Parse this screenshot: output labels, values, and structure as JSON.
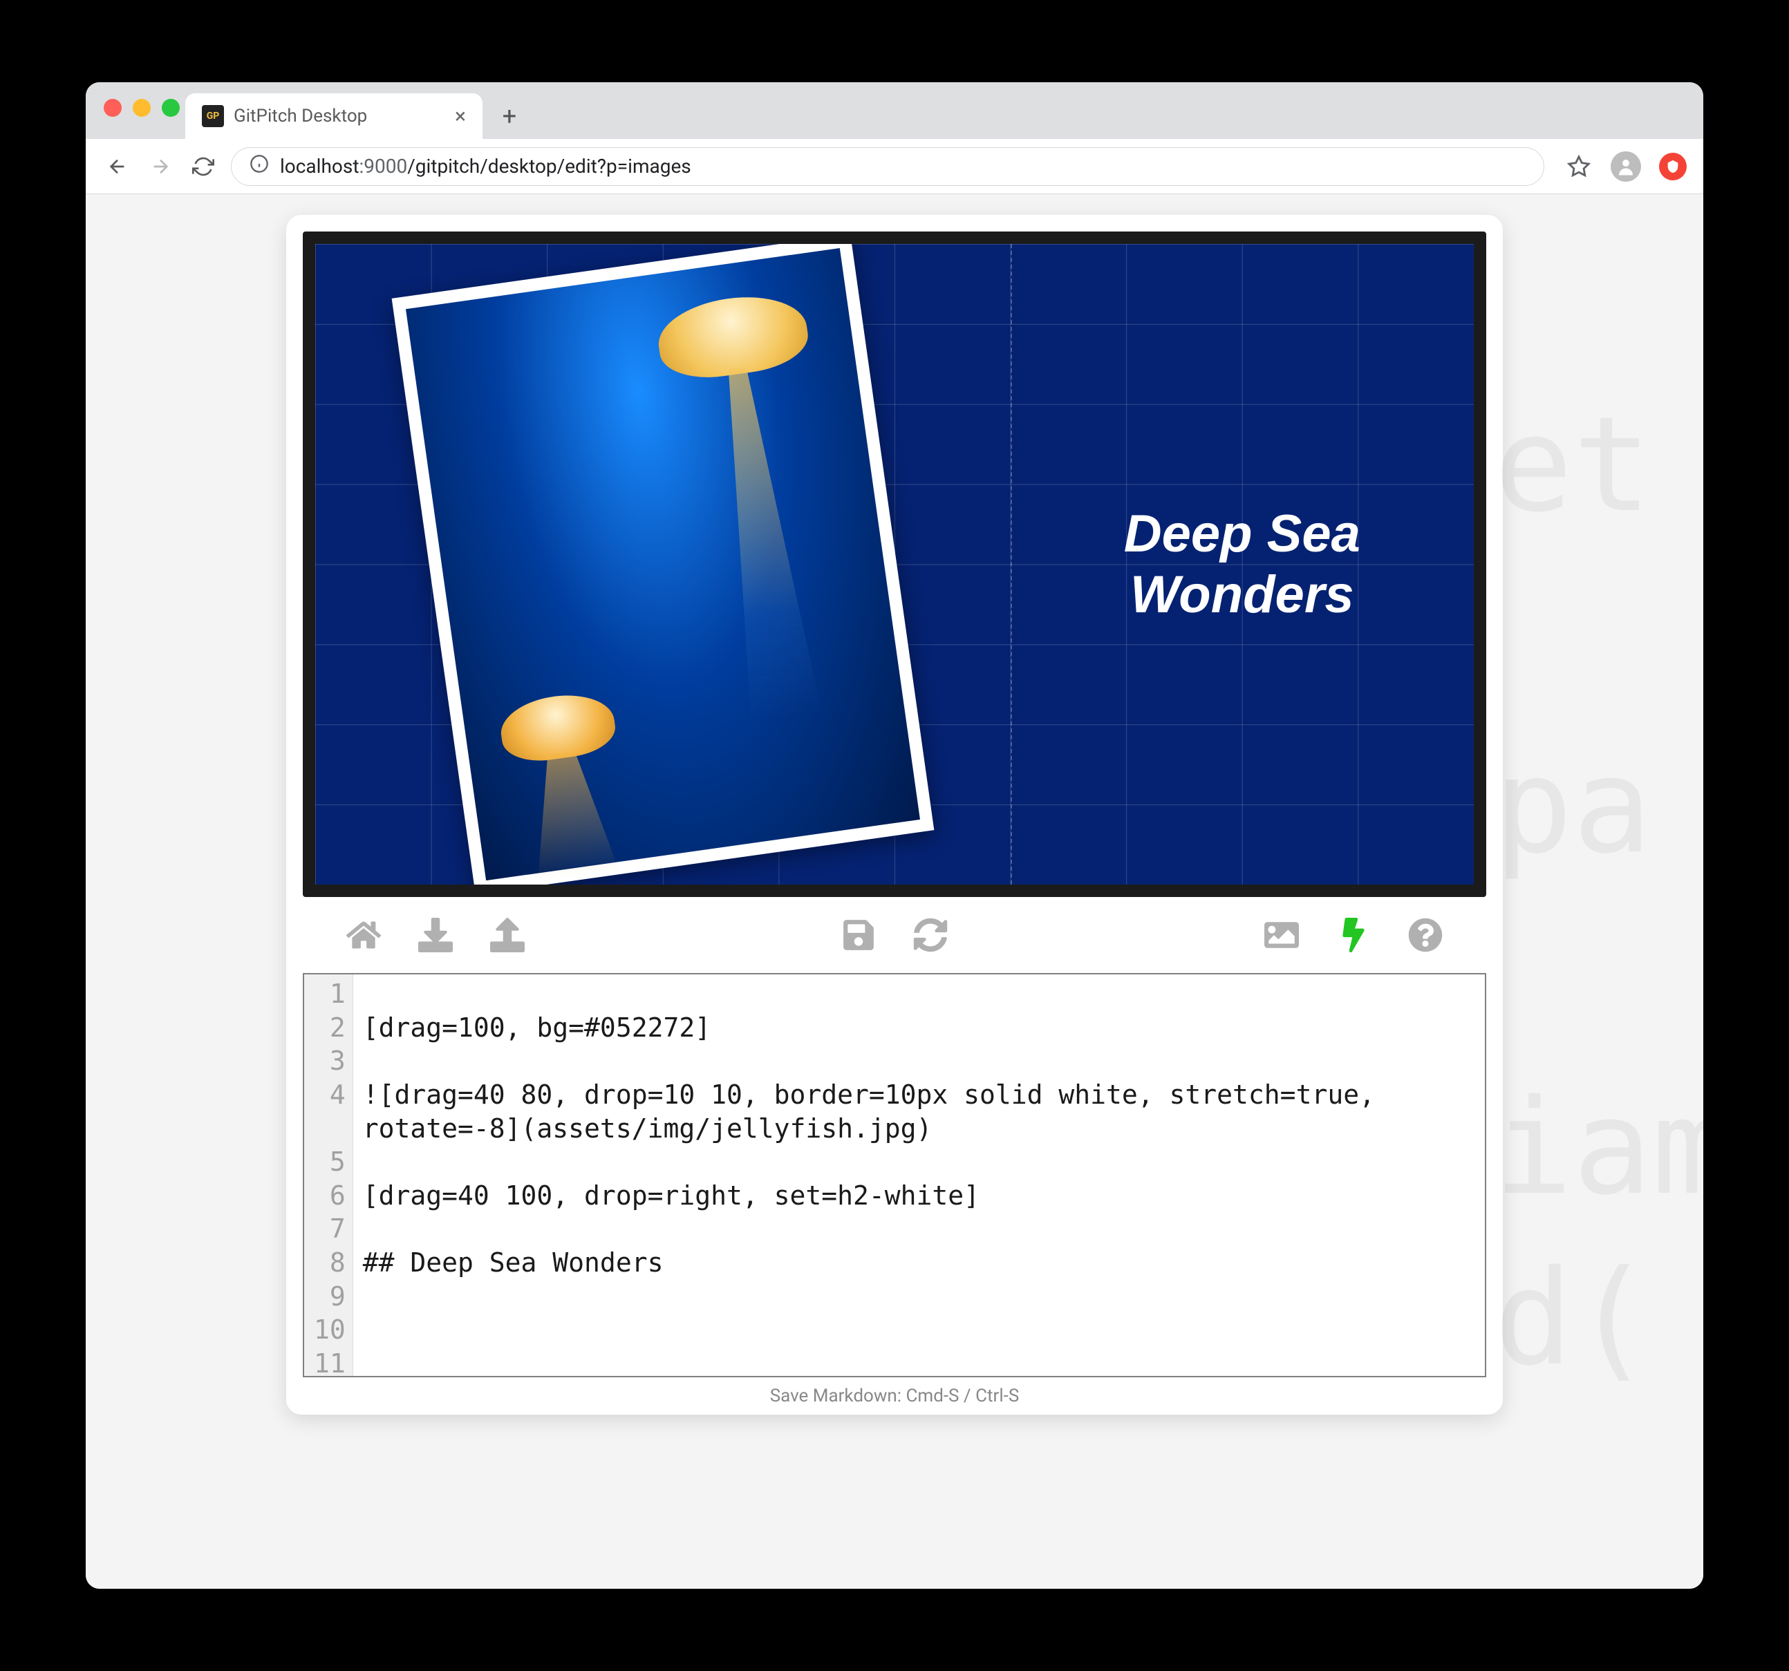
{
  "browser": {
    "tab_title": "GitPitch Desktop",
    "url_host": "localhost",
    "url_port": ":9000",
    "url_path": "/gitpitch/desktop/edit?p=images"
  },
  "slide": {
    "heading_line1": "Deep Sea",
    "heading_line2": "Wonders",
    "bg_color": "#052272"
  },
  "toolbar": {
    "home": "home-icon",
    "download": "download-icon",
    "upload": "upload-icon",
    "save": "save-icon",
    "refresh": "refresh-icon",
    "image": "image-icon",
    "bolt": "bolt-icon",
    "help": "help-icon"
  },
  "editor": {
    "gutter": " 1\n 2\n 3\n 4\n\n 5\n 6\n 7\n 8\n 9\n10\n11",
    "lines": [
      "",
      "[drag=100, bg=#052272]",
      "",
      "![drag=40 80, drop=10 10, border=10px solid white, stretch=true, rotate=-8](assets/img/jellyfish.jpg)",
      "",
      "[drag=40 100, drop=right, set=h2-white]",
      "",
      "## Deep Sea Wonders",
      "",
      "",
      ""
    ]
  },
  "status": "Save Markdown: Cmd-S / Ctrl-S",
  "bg_text": "et\n\npa\n\niam\nd("
}
